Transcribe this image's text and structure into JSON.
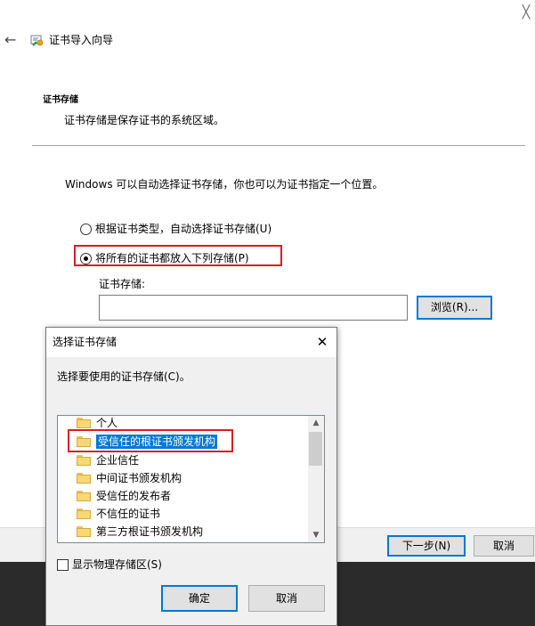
{
  "window": {
    "close_glyph": "╳",
    "back_glyph": "←",
    "title": "证书导入向导",
    "icon": "certificate-wizard-icon"
  },
  "section": {
    "title": "证书存储",
    "description": "证书存储是保存证书的系统区域。"
  },
  "intro_text": "Windows 可以自动选择证书存储，你也可以为证书指定一个位置。",
  "options": {
    "auto_label": "根据证书类型，自动选择证书存储(U)",
    "manual_label": "将所有的证书都放入下列存储(P)",
    "selected": "manual"
  },
  "store": {
    "label": "证书存储:",
    "value": "",
    "browse_label": "浏览(R)..."
  },
  "footer": {
    "next_label": "下一步(N)",
    "cancel_label": "取消"
  },
  "dialog": {
    "title": "选择证书存储",
    "close_glyph": "✕",
    "prompt": "选择要使用的证书存储(C)。",
    "items": [
      {
        "label": "个人"
      },
      {
        "label": "受信任的根证书颁发机构",
        "selected": true
      },
      {
        "label": "企业信任"
      },
      {
        "label": "中间证书颁发机构"
      },
      {
        "label": "受信任的发布者"
      },
      {
        "label": "不信任的证书"
      },
      {
        "label": "第三方根证书颁发机构"
      }
    ],
    "show_physical_label": "显示物理存储区(S)",
    "show_physical_checked": false,
    "ok_label": "确定",
    "cancel_label": "取消",
    "scroll_up_glyph": "▲",
    "scroll_down_glyph": "▼"
  },
  "colors": {
    "accent": "#0078d7",
    "highlight_border": "#d61f26",
    "taskbar": "#2b2b2b"
  }
}
